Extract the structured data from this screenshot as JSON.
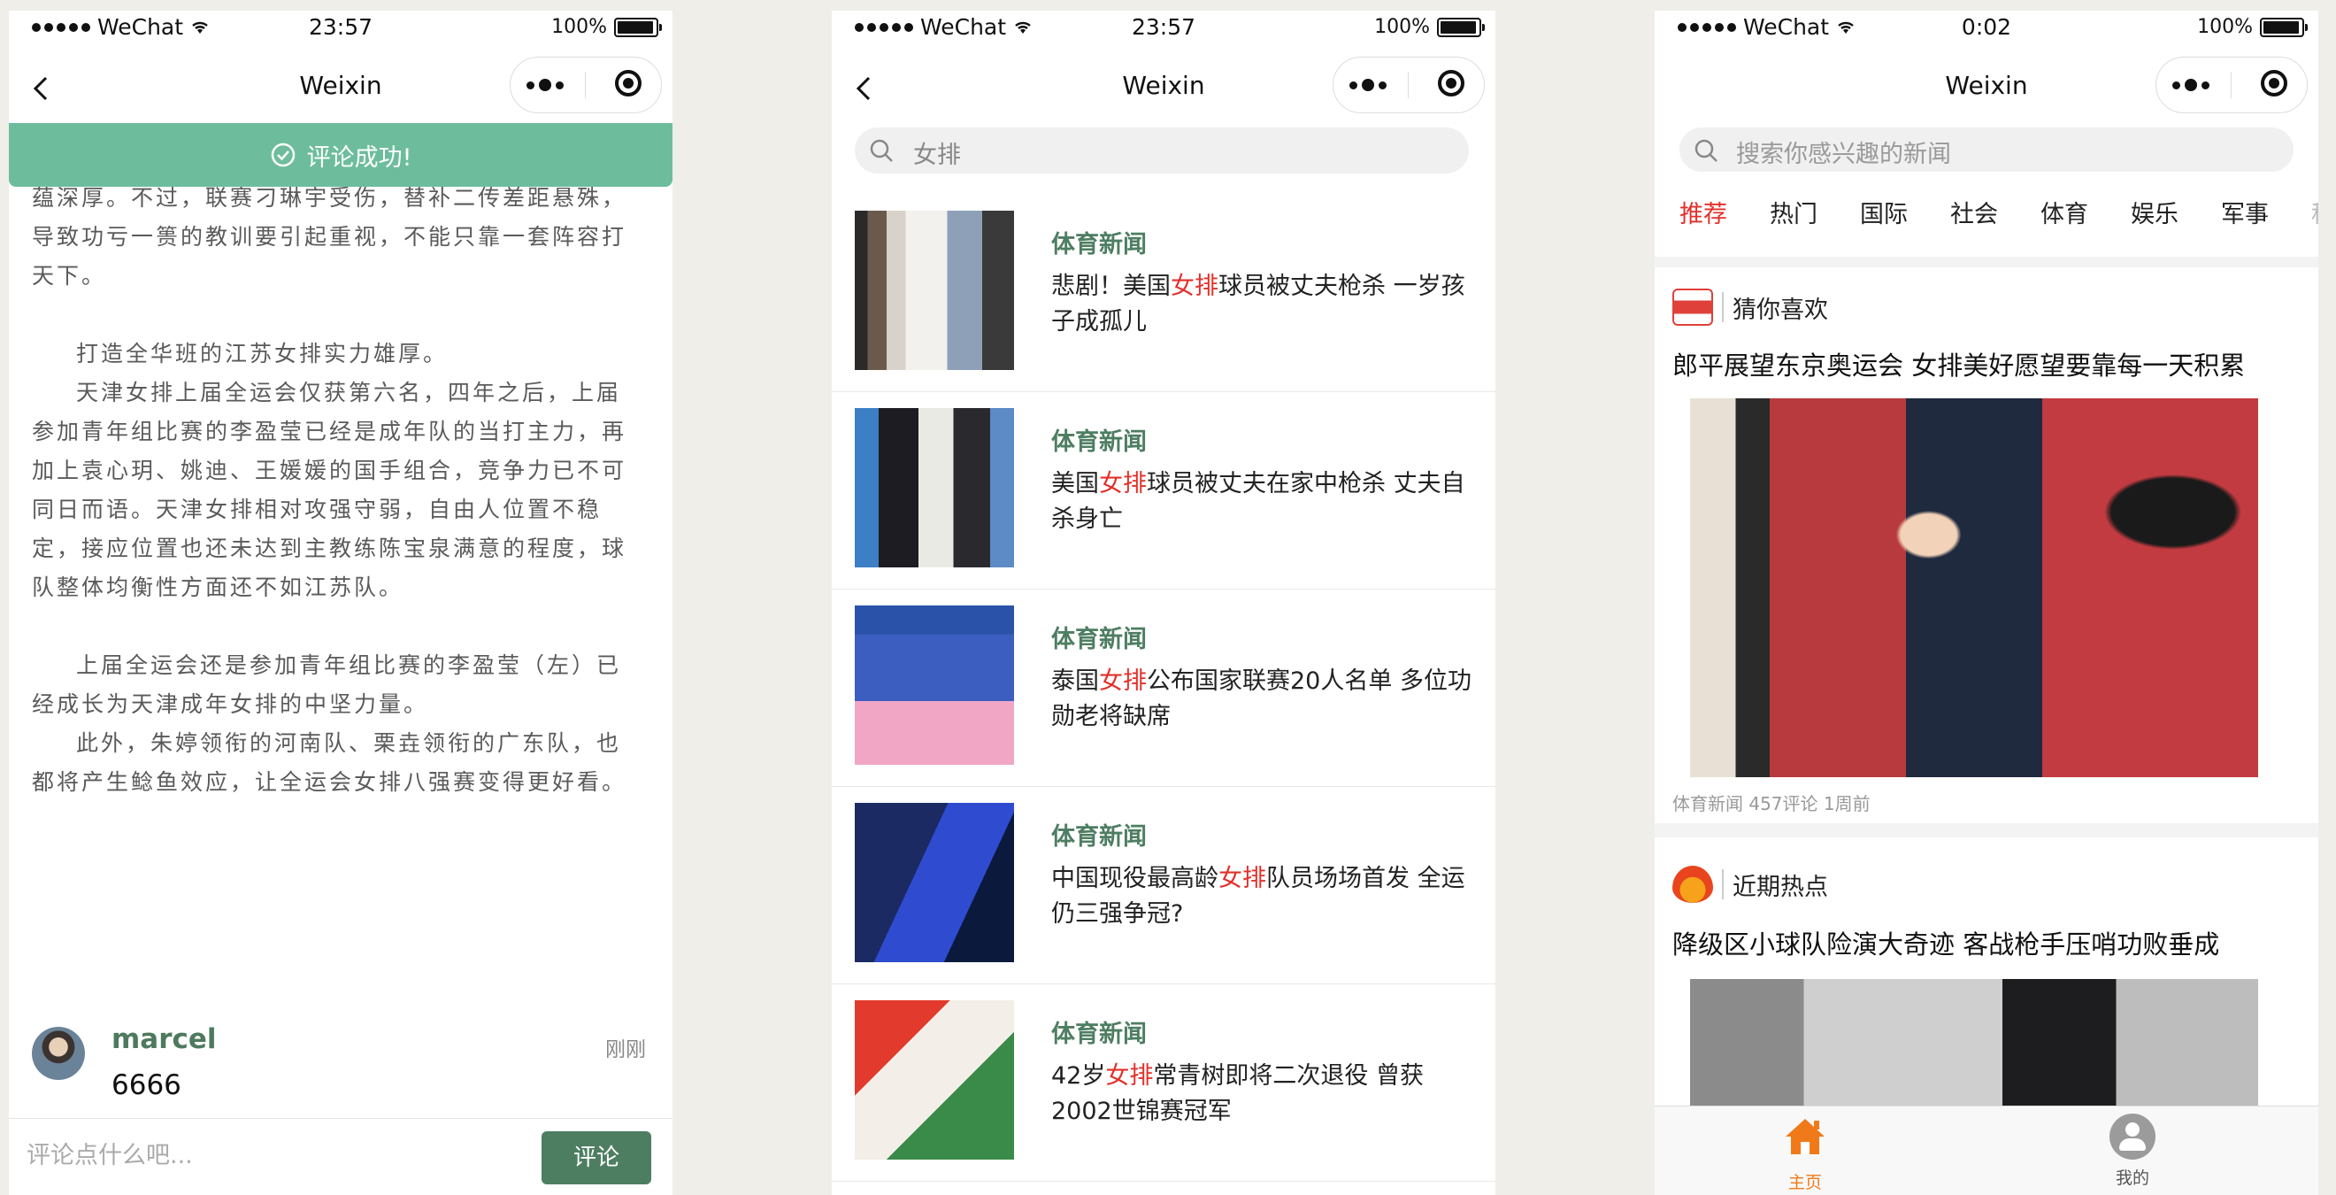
{
  "status_bar": {
    "carrier": "WeChat",
    "battery": "100%",
    "times": [
      "23:57",
      "23:57",
      "0:02"
    ]
  },
  "nav": {
    "title": "Weixin"
  },
  "comment_screen": {
    "toast": "评论成功!",
    "article_lines": [
      "蕴深厚。不过，联赛刁琳宇受伤，替补二传差距悬殊，",
      "导致功亏一篑的教训要引起重视，不能只靠一套阵容打",
      "天下。",
      "打造全华班的江苏女排实力雄厚。",
      "天津女排上届全运会仅获第六名，四年之后，上届参加青年组比赛的李盈莹已经是成年队的当打主力，再加上袁心玥、姚迪、王媛媛的国手组合，竞争力已不可同日而语。天津女排相对攻强守弱，自由人位置不稳定，接应位置也还未达到主教练陈宝泉满意的程度，球队整体均衡性方面还不如江苏队。",
      "上届全运会还是参加青年组比赛的李盈莹（左）已经成长为天津成年女排的中坚力量。",
      "此外，朱婷领衔的河南队、栗垚领衔的广东队，也都将产生鲶鱼效应，让全运会女排八强赛变得更好看。"
    ],
    "comment": {
      "user": "marcel",
      "time": "刚刚",
      "text": "6666"
    },
    "input_placeholder": "评论点什么吧...",
    "submit_label": "评论"
  },
  "search_screen": {
    "query": "女排",
    "results": [
      {
        "tag": "体育新闻",
        "before": "悲剧！美国",
        "highlight": "女排",
        "after": "球员被丈夫枪杀 一岁孩子成孤儿"
      },
      {
        "tag": "体育新闻",
        "before": "美国",
        "highlight": "女排",
        "after": "球员被丈夫在家中枪杀 丈夫自杀身亡"
      },
      {
        "tag": "体育新闻",
        "before": "泰国",
        "highlight": "女排",
        "after": "公布国家联赛20人名单 多位功勋老将缺席"
      },
      {
        "tag": "体育新闻",
        "before": "中国现役最高龄",
        "highlight": "女排",
        "after": "队员场场首发 全运仍三强争冠?"
      },
      {
        "tag": "体育新闻",
        "before": "42岁",
        "highlight": "女排",
        "after": "常青树即将二次退役 曾获2002世锦赛冠军"
      }
    ]
  },
  "home_screen": {
    "search_placeholder": "搜索你感兴趣的新闻",
    "tabs": [
      "推荐",
      "热门",
      "国际",
      "社会",
      "体育",
      "娱乐",
      "军事",
      "科"
    ],
    "active_tab": "推荐",
    "section1": {
      "label": "猜你喜欢",
      "title": "郎平展望东京奥运会 女排美好愿望要靠每一天积累",
      "meta": "体育新闻 457评论 1周前"
    },
    "section2": {
      "label": "近期热点",
      "title": "降级区小球队险演大奇迹 客战枪手压哨功败垂成"
    },
    "tabbar": {
      "home": "主页",
      "me": "我的"
    }
  },
  "colors": {
    "accent_green": "#4e7e62",
    "toast_green": "#6dbd9d",
    "highlight_red": "#e2302a",
    "home_orange": "#f07a1a"
  }
}
